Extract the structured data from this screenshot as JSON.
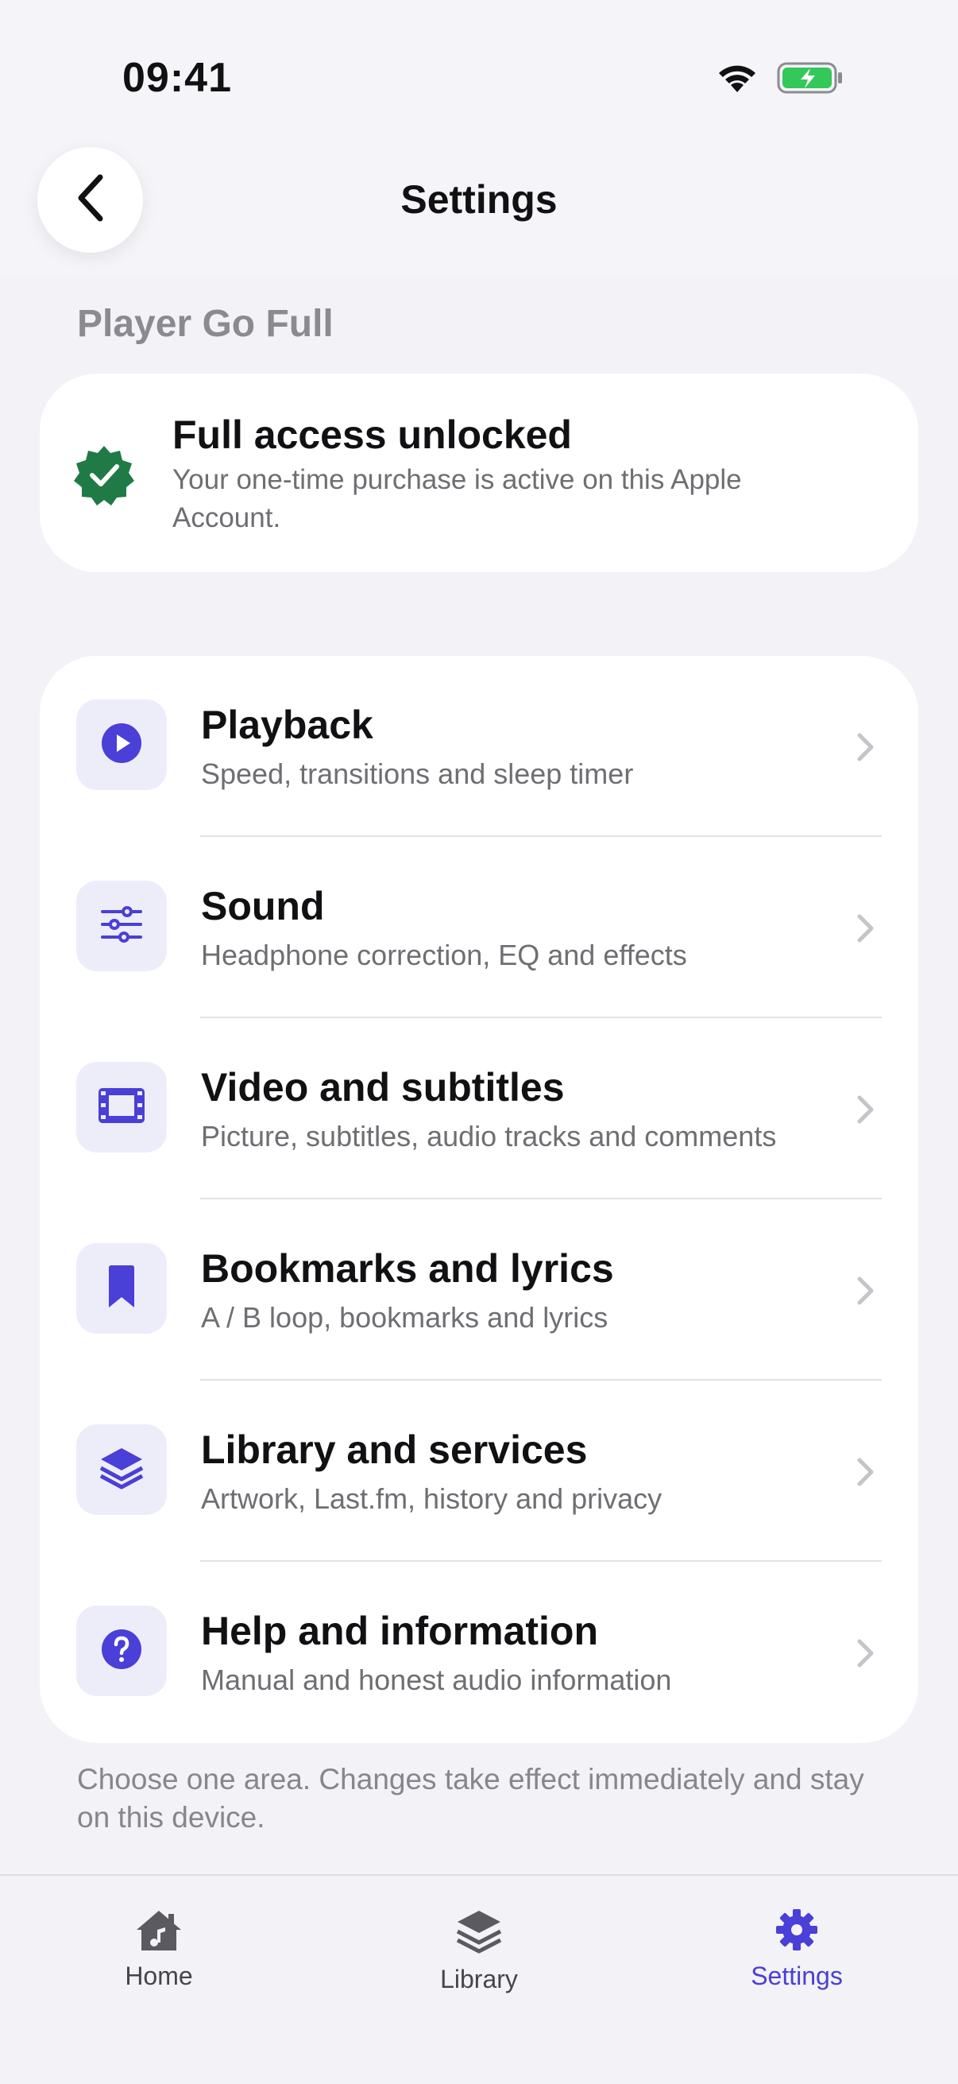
{
  "status_bar": {
    "time": "09:41"
  },
  "nav": {
    "title": "Settings"
  },
  "section_header": "Player Go Full",
  "purchase": {
    "title": "Full access unlocked",
    "description": "Your one-time purchase is active on this Apple Account."
  },
  "menu": [
    {
      "title": "Playback",
      "subtitle": "Speed, transitions and sleep timer",
      "icon": "play-icon"
    },
    {
      "title": "Sound",
      "subtitle": "Headphone correction, EQ and effects",
      "icon": "sliders-icon"
    },
    {
      "title": "Video and subtitles",
      "subtitle": "Picture, subtitles, audio tracks and comments",
      "icon": "film-icon"
    },
    {
      "title": "Bookmarks and lyrics",
      "subtitle": "A / B loop, bookmarks and lyrics",
      "icon": "bookmark-icon"
    },
    {
      "title": "Library and services",
      "subtitle": "Artwork, Last.fm, history and privacy",
      "icon": "layers-icon"
    },
    {
      "title": "Help and information",
      "subtitle": "Manual and honest audio information",
      "icon": "question-icon"
    }
  ],
  "footer_note": "Choose one area. Changes take effect immediately and stay on this device.",
  "tabs": [
    {
      "label": "Home",
      "icon": "home-music-icon",
      "active": false
    },
    {
      "label": "Library",
      "icon": "layers-icon",
      "active": false
    },
    {
      "label": "Settings",
      "icon": "gear-icon",
      "active": true
    }
  ],
  "colors": {
    "accent": "#4a3fd6",
    "tile_background": "#ededfa",
    "verified_green": "#1f7a45",
    "battery_green": "#34c759"
  }
}
